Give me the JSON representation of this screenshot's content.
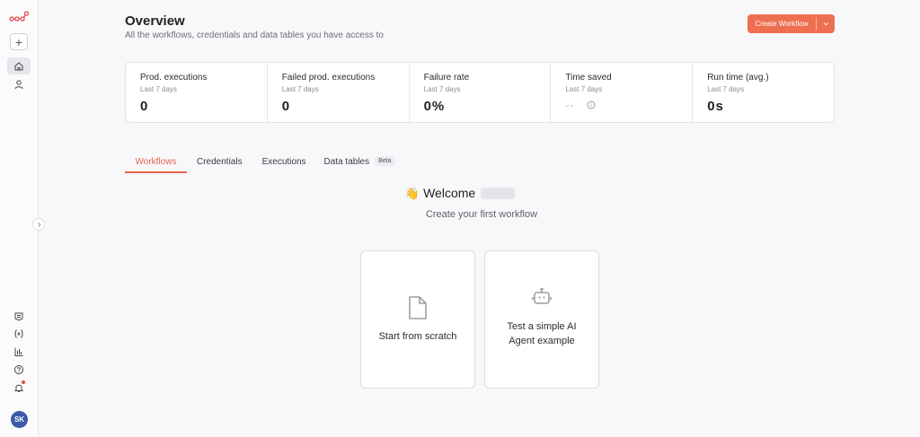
{
  "header": {
    "title": "Overview",
    "subtitle": "All the workflows, credentials and data tables you have access to",
    "create_button": "Create Workflow"
  },
  "sidebar": {
    "add_label": "+",
    "avatar_initials": "SK",
    "items": [
      {
        "name": "home",
        "icon": "home-icon",
        "active": true
      },
      {
        "name": "personal",
        "icon": "user-icon",
        "active": false
      }
    ],
    "bottom_items": [
      {
        "name": "templates",
        "icon": "templates-icon"
      },
      {
        "name": "variables",
        "icon": "variables-icon"
      },
      {
        "name": "insights",
        "icon": "chart-icon"
      },
      {
        "name": "help",
        "icon": "help-icon"
      },
      {
        "name": "notifications",
        "icon": "bell-icon",
        "has_badge": true
      }
    ]
  },
  "stats": [
    {
      "label": "Prod. executions",
      "sub": "Last 7 days",
      "value": "0"
    },
    {
      "label": "Failed prod. executions",
      "sub": "Last 7 days",
      "value": "0"
    },
    {
      "label": "Failure rate",
      "sub": "Last 7 days",
      "value": "0%"
    },
    {
      "label": "Time saved",
      "sub": "Last 7 days",
      "value": "--"
    },
    {
      "label": "Run time (avg.)",
      "sub": "Last 7 days",
      "value": "0s"
    }
  ],
  "tabs": [
    {
      "label": "Workflows",
      "active": true
    },
    {
      "label": "Credentials",
      "active": false
    },
    {
      "label": "Executions",
      "active": false
    },
    {
      "label": "Data tables",
      "active": false,
      "badge": "Beta"
    }
  ],
  "welcome": {
    "emoji": "👋",
    "greeting": "Welcome",
    "subtitle": "Create your first workflow"
  },
  "cards": [
    {
      "label": "Start from scratch",
      "icon": "file-icon"
    },
    {
      "label": "Test a simple AI Agent example",
      "icon": "robot-icon"
    }
  ],
  "colors": {
    "accent": "#ee6e50",
    "active_tab": "#e8624a",
    "avatar": "#3d5aa8",
    "background": "#f8f8fa"
  }
}
